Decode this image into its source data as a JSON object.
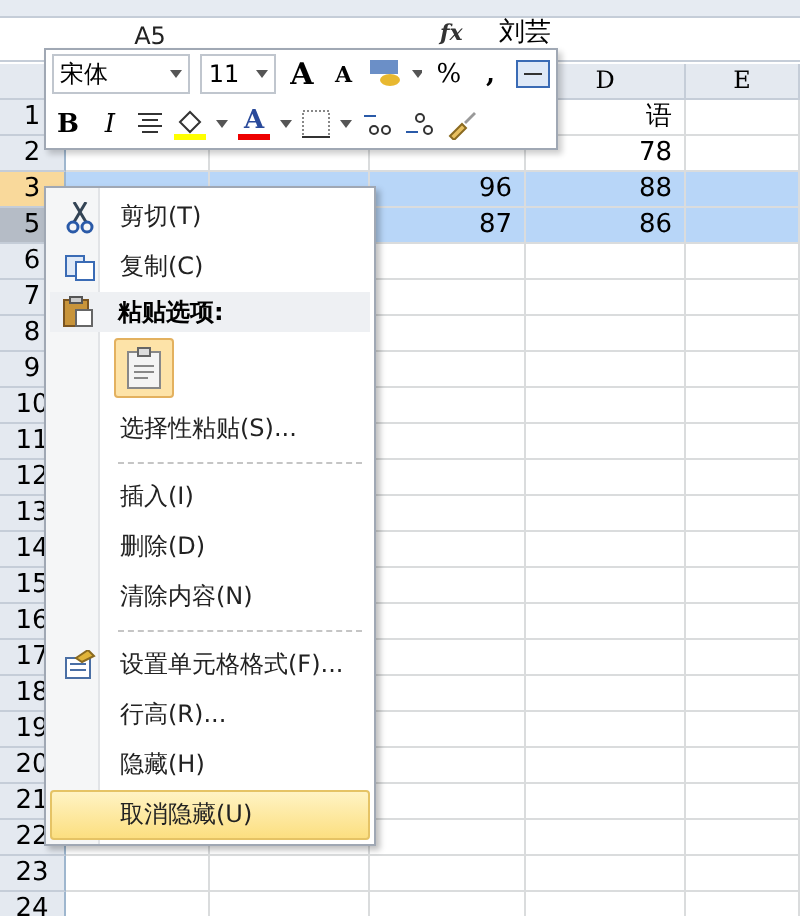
{
  "formula_bar": {
    "name_box": "A5",
    "fx": "fx",
    "value": "刘芸"
  },
  "column_headers": [
    "D",
    "E"
  ],
  "rows": [
    {
      "number": "1",
      "selected": false,
      "active": false,
      "cells": {
        "D": "语"
      }
    },
    {
      "number": "2",
      "selected": false,
      "active": false,
      "cells": {
        "D": "78"
      }
    },
    {
      "number": "3",
      "selected": true,
      "active": true,
      "cells": {
        "C": "96",
        "D": "88"
      }
    },
    {
      "number": "5",
      "selected": true,
      "active": false,
      "cells": {
        "C": "87",
        "D": "86"
      }
    },
    {
      "number": "6",
      "selected": false,
      "active": false,
      "cells": {}
    },
    {
      "number": "7",
      "selected": false,
      "active": false,
      "cells": {}
    },
    {
      "number": "8",
      "selected": false,
      "active": false,
      "cells": {}
    },
    {
      "number": "9",
      "selected": false,
      "active": false,
      "cells": {}
    },
    {
      "number": "10",
      "selected": false,
      "active": false,
      "cells": {}
    },
    {
      "number": "11",
      "selected": false,
      "active": false,
      "cells": {}
    },
    {
      "number": "12",
      "selected": false,
      "active": false,
      "cells": {}
    },
    {
      "number": "13",
      "selected": false,
      "active": false,
      "cells": {}
    },
    {
      "number": "14",
      "selected": false,
      "active": false,
      "cells": {}
    },
    {
      "number": "15",
      "selected": false,
      "active": false,
      "cells": {}
    },
    {
      "number": "16",
      "selected": false,
      "active": false,
      "cells": {}
    },
    {
      "number": "17",
      "selected": false,
      "active": false,
      "cells": {}
    },
    {
      "number": "18",
      "selected": false,
      "active": false,
      "cells": {}
    },
    {
      "number": "19",
      "selected": false,
      "active": false,
      "cells": {}
    },
    {
      "number": "20",
      "selected": false,
      "active": false,
      "cells": {}
    },
    {
      "number": "21",
      "selected": false,
      "active": false,
      "cells": {}
    },
    {
      "number": "22",
      "selected": false,
      "active": false,
      "cells": {}
    },
    {
      "number": "23",
      "selected": false,
      "active": false,
      "cells": {}
    },
    {
      "number": "24",
      "selected": false,
      "active": false,
      "cells": {}
    }
  ],
  "mini_toolbar": {
    "font": "宋体",
    "size": "11",
    "grow": "A",
    "shrink": "A",
    "percent": "%",
    "comma": ",",
    "bold": "B",
    "italic": "I",
    "font_color": "A"
  },
  "context_menu": [
    {
      "kind": "cut",
      "label": "剪切(T)",
      "selected": false
    },
    {
      "kind": "copy",
      "label": "复制(C)",
      "selected": false
    },
    {
      "kind": "header",
      "label": "粘贴选项:"
    },
    {
      "kind": "paste"
    },
    {
      "kind": "item",
      "label": "选择性粘贴(S)...",
      "selected": false
    },
    {
      "kind": "separator"
    },
    {
      "kind": "item",
      "label": "插入(I)",
      "selected": false
    },
    {
      "kind": "item",
      "label": "删除(D)",
      "selected": false
    },
    {
      "kind": "item",
      "label": "清除内容(N)",
      "selected": false
    },
    {
      "kind": "separator"
    },
    {
      "kind": "format",
      "label": "设置单元格格式(F)...",
      "selected": false
    },
    {
      "kind": "item",
      "label": "行高(R)...",
      "selected": false
    },
    {
      "kind": "item",
      "label": "隐藏(H)",
      "selected": false
    },
    {
      "kind": "item",
      "label": "取消隐藏(U)",
      "selected": true
    }
  ]
}
